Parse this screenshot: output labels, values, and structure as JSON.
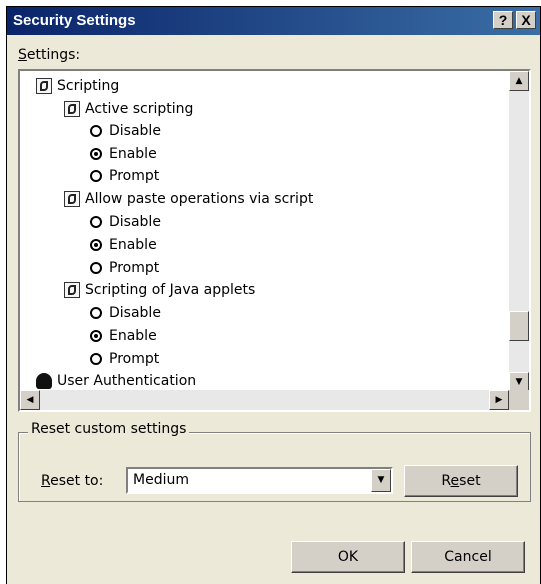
{
  "window": {
    "title": "Security Settings",
    "help_btn": "?",
    "close_btn": "X"
  },
  "settings": {
    "label_access": "S",
    "label_rest": "ettings:"
  },
  "tree": {
    "scripting": "Scripting",
    "active_scripting": "Active scripting",
    "as_disable": "Disable",
    "as_enable": "Enable",
    "as_prompt": "Prompt",
    "allow_paste": "Allow paste operations via script",
    "ap_disable": "Disable",
    "ap_enable": "Enable",
    "ap_prompt": "Prompt",
    "java_applets": "Scripting of Java applets",
    "ja_disable": "Disable",
    "ja_enable": "Enable",
    "ja_prompt": "Prompt",
    "user_auth": "User Authentication"
  },
  "selected": {
    "active_scripting": "Enable",
    "allow_paste": "Enable",
    "java_applets": "Enable"
  },
  "reset": {
    "group_label": "Reset custom settings",
    "reset_to_access": "R",
    "reset_to_rest": "eset to:",
    "dropdown_value": "Medium",
    "button_pre": "R",
    "button_access": "e",
    "button_rest": "set"
  },
  "buttons": {
    "ok": "OK",
    "cancel": "Cancel"
  },
  "colors": {
    "titlebar_start": "#0a246a",
    "titlebar_end": "#3a6ea5",
    "dialog_bg": "#ece9d8"
  }
}
